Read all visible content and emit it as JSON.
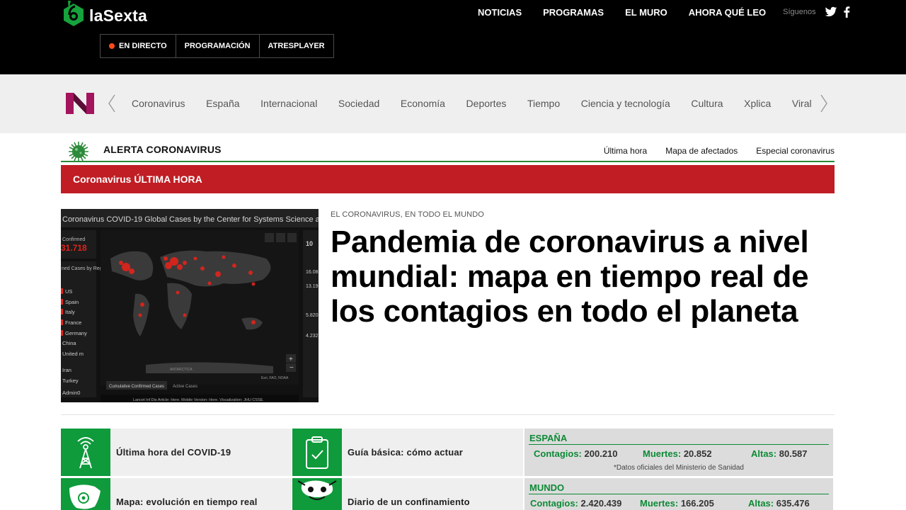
{
  "brand": {
    "name": "laSexta",
    "green": "#16a23c"
  },
  "topnav": {
    "items": [
      "NOTICIAS",
      "PROGRAMAS",
      "EL MURO",
      "AHORA QUÉ LEO"
    ],
    "follow_label": "Síguenos",
    "social_icons": [
      "twitter-icon",
      "facebook-icon"
    ]
  },
  "livebar": {
    "items": [
      "EN DIRECTO",
      "PROGRAMACIÓN",
      "ATRESPLAYER"
    ]
  },
  "categories": [
    "Coronavirus",
    "España",
    "Internacional",
    "Sociedad",
    "Economía",
    "Deportes",
    "Tiempo",
    "Ciencia y tecnología",
    "Cultura",
    "Xplica",
    "Viral"
  ],
  "alert": {
    "title": "ALERTA CORONAVIRUS",
    "links": [
      "Última hora",
      "Mapa de afectados",
      "Especial coronavirus"
    ]
  },
  "redbar": {
    "label": "Coronavirus ÚLTIMA HORA",
    "color": "#c01d24"
  },
  "lead": {
    "kicker": "EL CORONAVIRUS, EN TODO EL MUNDO",
    "headline": "Pandemia de coronavirus a nivel mundial: mapa en tiempo real de los contagios en todo el planeta",
    "image": {
      "title": "Coronavirus COVID-19 Global Cases by the Center for Systems Science a",
      "confirmed_label": "Confirmed",
      "confirmed_value": "31.718",
      "list_header": "ned Cases by Region/Sovereignty",
      "countries": [
        "US",
        "Spain",
        "Italy",
        "France",
        "Germany",
        "China",
        "United m",
        "Iran",
        "Turkey",
        "Admin0"
      ],
      "right_values": [
        "10",
        "16.08",
        "13.19",
        "5.820",
        "4.232"
      ],
      "tabs": [
        "Cumulative Confirmed Cases",
        "Active Cases"
      ],
      "footer": "Lancet Inf Dis Article: Here. Mobile Version: Here. Visualization: JHU CSSE.",
      "attribution": "Esri, FAO, NOAA",
      "map_label": "ANTARCTICA"
    }
  },
  "tiles": [
    {
      "label": "Última hora del COVID-19",
      "icon": "antenna-icon"
    },
    {
      "label": "Guía básica: cómo actuar",
      "icon": "clipboard-check-icon"
    },
    {
      "label": "Mapa: evolución en tiempo real",
      "icon": "spain-map-icon"
    },
    {
      "label": "Diario de un confinamiento",
      "icon": "illustration-icon"
    }
  ],
  "stats": {
    "spain": {
      "region": "ESPAÑA",
      "contagios_label": "Contagios:",
      "contagios": "200.210",
      "muertes_label": "Muertes:",
      "muertes": "20.852",
      "altas_label": "Altas:",
      "altas": "80.587",
      "note": "*Datos oficiales del Ministerio de Sanidad"
    },
    "world": {
      "region": "MUNDO",
      "contagios_label": "Contagios:",
      "contagios": "2.420.439",
      "muertes_label": "Muertes:",
      "muertes": "166.205",
      "altas_label": "Altas:",
      "altas": "635.476"
    }
  }
}
